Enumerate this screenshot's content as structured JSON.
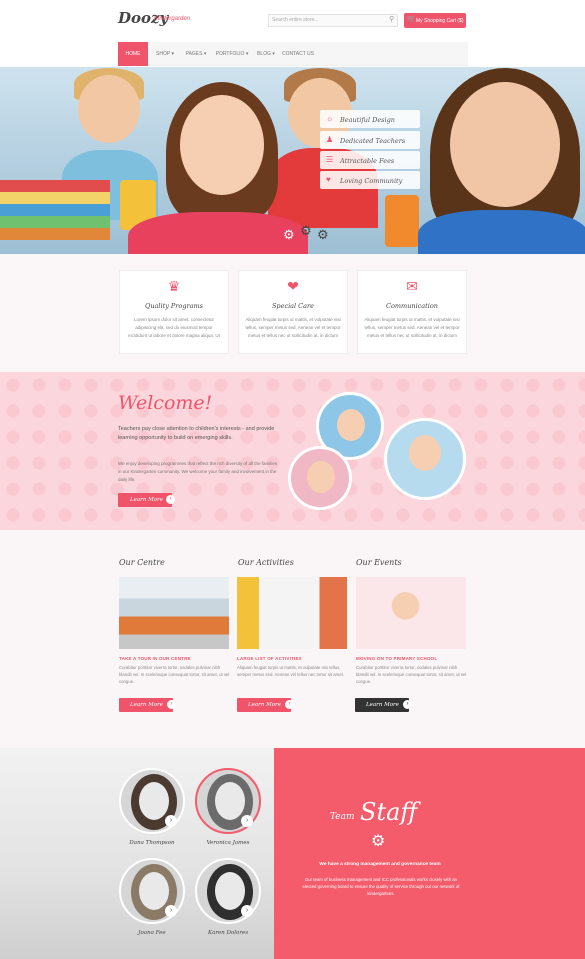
{
  "header": {
    "logo": "Doozy",
    "logo_sub": "Kindergarden",
    "search_placeholder": "Search entire store...",
    "search_icon": "search-icon",
    "cart_label": "My Shopping Cart ($)",
    "cart_icon": "cart-icon"
  },
  "nav": {
    "items": [
      {
        "label": "HOME"
      },
      {
        "label": "SHOP ▾"
      },
      {
        "label": "PAGES ▾"
      },
      {
        "label": "PORTFOLIO ▾"
      },
      {
        "label": "BLOG ▾"
      },
      {
        "label": "CONTACT US"
      }
    ]
  },
  "hero": {
    "features": [
      {
        "label": "Beautiful Design",
        "icon": "sun-icon"
      },
      {
        "label": "Dedicated Teachers",
        "icon": "people-icon"
      },
      {
        "label": "Attractable Fees",
        "icon": "book-icon"
      },
      {
        "label": "Loving Community",
        "icon": "heart-icon"
      }
    ]
  },
  "services": [
    {
      "title": "Quality Programs",
      "icon": "crown-icon",
      "text": "Lorem ipsum dolor sit amet, consectetur adipisicing elit, sed do eiusmod tempor incididunt ut labore et dolore magna aliqua. Ut enim ad minim veniam, quis nostrud exercitation ullamco laboris nisi ut aliquip."
    },
    {
      "title": "Special Care",
      "icon": "hand-heart-icon",
      "text": "Aliquam feugiat turpis ut mattis, et vulputate nisi tellus, semper metus sed. Aenean vel et tempor metus et tellus nec ut sollicitudin at, in dictum condimentum tortor."
    },
    {
      "title": "Communication",
      "icon": "chat-icon",
      "text": "Aliquam feugiat turpis ut mattis, et vulputate nisi tellus, semper metus sed. Aenean vel et tempor metus et tellus nec ut sollicitudin at, in dictum condimentum tortor."
    }
  ],
  "welcome": {
    "title": "Welcome!",
    "lead": "Teachers pay close attention to children's interests - and provide learning opportunity to build on emerging skills.",
    "text": "We enjoy developing programmes that reflect the rich diversity of all the families in our Kindergarten community. We welcome your family and involvement in the daily life.",
    "button": "Learn More"
  },
  "columns": [
    {
      "title": "Our Centre",
      "subtitle": "TAKE A TOUR IN OUR CENTRE",
      "text": "Curabitur porttitor viverra tortor, sodales pulvinar nibh blandit vel. In scelerisque consequat tortor, sit amet, ut vel congue.",
      "button": "Learn More"
    },
    {
      "title": "Our Activities",
      "subtitle": "LARGE LIST OF ACTIVITIES",
      "text": "Aliquam feugiat turpis ut mattis, et vulputate nisi tellus, semper metus sed. Aenean vel tellus nec tortor sit amet.",
      "button": "Learn More"
    },
    {
      "title": "Our Events",
      "subtitle": "MOVING ON TO PRIMARY SCHOOL",
      "text": "Curabitur porttitor viverra tortor, sodales pulvinar nibh blandit vel. In scelerisque consequat tortor, sit amet, ut vel congue.",
      "button": "Learn More"
    }
  ],
  "team": {
    "members": [
      {
        "name": "Dana Thompson"
      },
      {
        "name": "Veronica James"
      },
      {
        "name": "Joana Fee"
      },
      {
        "name": "Karen Dolores"
      }
    ],
    "heading_small": "Team",
    "heading_big": "Staff",
    "lead": "We have a strong management and governance team",
    "text": "Our team of business management and ICC professionals works closely with an elected governing board to ensure the quality of service through out our network of kindergartens."
  },
  "colors": {
    "accent": "#f0546a",
    "team_bg": "#f45c6c",
    "welcome_bg": "#fbd6dc"
  }
}
